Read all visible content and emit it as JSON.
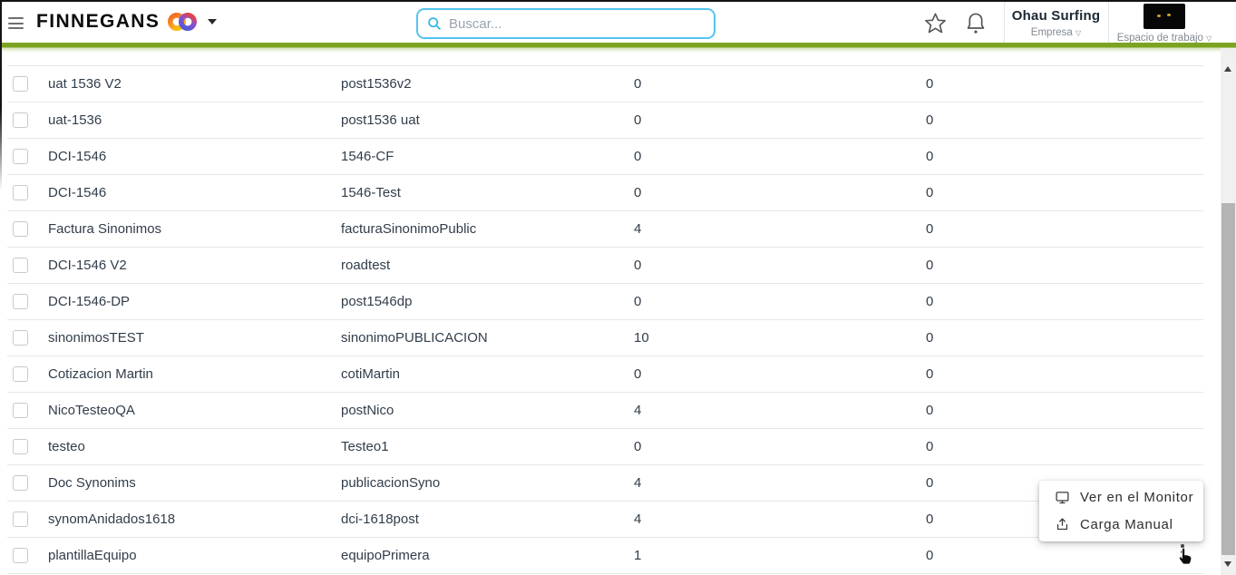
{
  "header": {
    "brand": "FINNEGANS",
    "search": {
      "placeholder": "Buscar..."
    },
    "company_name": "Ohau Surfing",
    "company_sub": "Empresa",
    "workspace_sub": "Espacio de trabajo",
    "caret_glyph": "▽"
  },
  "table": {
    "rows": [
      {
        "name": "uat 1536 V2",
        "code": "post1536v2",
        "count_a": "0",
        "count_b": "0"
      },
      {
        "name": "uat-1536",
        "code": "post1536 uat",
        "count_a": "0",
        "count_b": "0"
      },
      {
        "name": "DCI-1546",
        "code": "1546-CF",
        "count_a": "0",
        "count_b": "0"
      },
      {
        "name": "DCI-1546",
        "code": "1546-Test",
        "count_a": "0",
        "count_b": "0"
      },
      {
        "name": "Factura Sinonimos",
        "code": "facturaSinonimoPublic",
        "count_a": "4",
        "count_b": "0"
      },
      {
        "name": "DCI-1546 V2",
        "code": "roadtest",
        "count_a": "0",
        "count_b": "0"
      },
      {
        "name": "DCI-1546-DP",
        "code": "post1546dp",
        "count_a": "0",
        "count_b": "0"
      },
      {
        "name": "sinonimosTEST",
        "code": "sinonimoPUBLICACION",
        "count_a": "10",
        "count_b": "0"
      },
      {
        "name": "Cotizacion Martin",
        "code": "cotiMartin",
        "count_a": "0",
        "count_b": "0"
      },
      {
        "name": "NicoTesteoQA",
        "code": "postNico",
        "count_a": "4",
        "count_b": "0"
      },
      {
        "name": "testeo",
        "code": "Testeo1",
        "count_a": "0",
        "count_b": "0"
      },
      {
        "name": "Doc Synonims",
        "code": "publicacionSyno",
        "count_a": "4",
        "count_b": "0"
      },
      {
        "name": "synomAnidados1618",
        "code": "dci-1618post",
        "count_a": "4",
        "count_b": "0"
      },
      {
        "name": "plantillaEquipo",
        "code": "equipoPrimera",
        "count_a": "1",
        "count_b": "0"
      }
    ]
  },
  "context_menu": {
    "items": [
      {
        "icon": "monitor-icon",
        "label": "Ver en el Monitor"
      },
      {
        "icon": "upload-icon",
        "label": "Carga Manual"
      }
    ]
  },
  "colors": {
    "accent_green": "#7da322",
    "search_border": "#55c4ee",
    "search_icon": "#2bb6e4",
    "text_dark": "#313d4a",
    "text_gray": "#828a92",
    "separator": "#e7e7e7",
    "brand_ring_left": "#f59b1e",
    "brand_ring_right": "#6f59cf"
  }
}
